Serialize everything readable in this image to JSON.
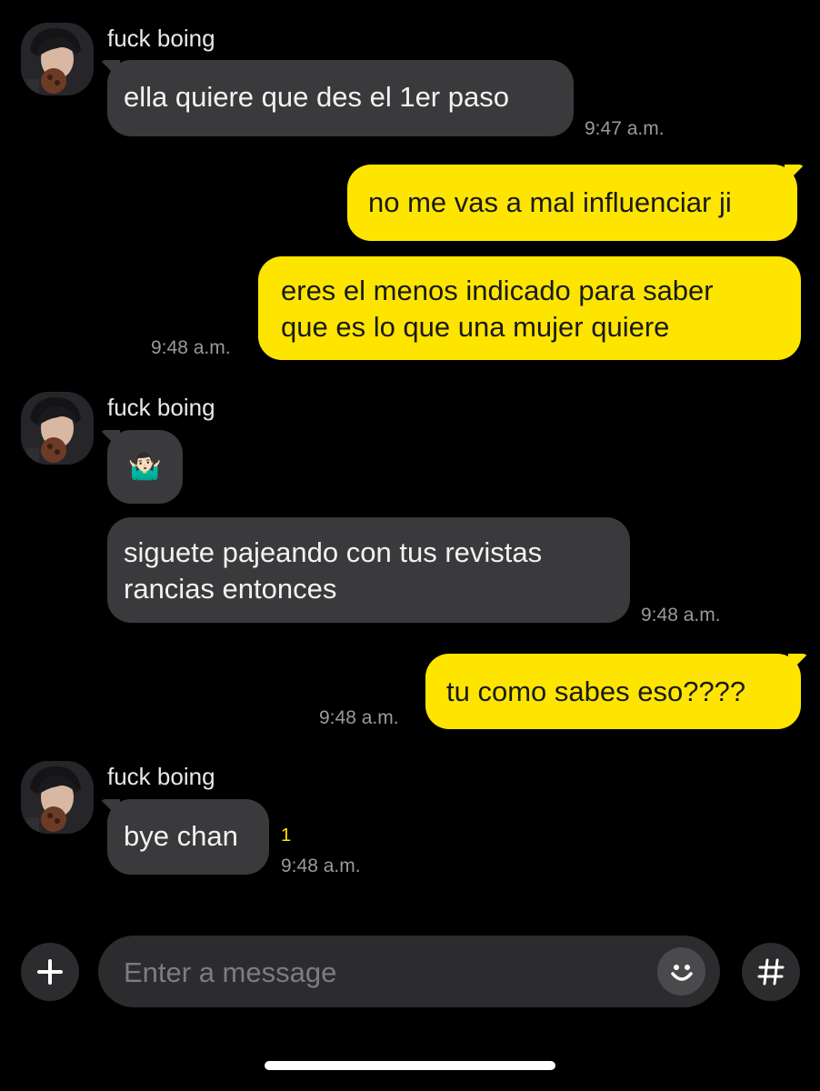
{
  "conversation": {
    "groups": [
      {
        "sender": "fuck boing",
        "messages": [
          {
            "text": "ella quiere que des el 1er paso",
            "time": "9:47 a.m."
          }
        ]
      },
      {
        "sender": "me",
        "messages": [
          {
            "text": "no me vas a mal influenciar ji",
            "time": ""
          },
          {
            "text": "eres el menos indicado para saber\nque es lo que una mujer quiere",
            "time": "9:48 a.m."
          }
        ]
      },
      {
        "sender": "fuck boing",
        "messages": [
          {
            "text": "🤷🏻‍♂️",
            "time": ""
          },
          {
            "text": "siguete pajeando con tus revistas\nrancias entonces",
            "time": "9:48 a.m."
          }
        ]
      },
      {
        "sender": "me",
        "messages": [
          {
            "text": "tu como sabes eso????",
            "time": "9:48 a.m."
          }
        ]
      },
      {
        "sender": "fuck boing",
        "messages": [
          {
            "text": "bye chan",
            "time": "9:48 a.m.",
            "unread": "1"
          }
        ]
      }
    ]
  },
  "composer": {
    "placeholder": "Enter a message",
    "add_icon": "plus-icon",
    "emoji_icon": "smiley-icon",
    "hashtag_icon": "hashtag-icon"
  },
  "colors": {
    "background": "#000000",
    "incoming_bubble": "#3a3a3c",
    "outgoing_bubble": "#fee500",
    "timestamp": "#9a9a9a",
    "unread": "#fee500"
  }
}
